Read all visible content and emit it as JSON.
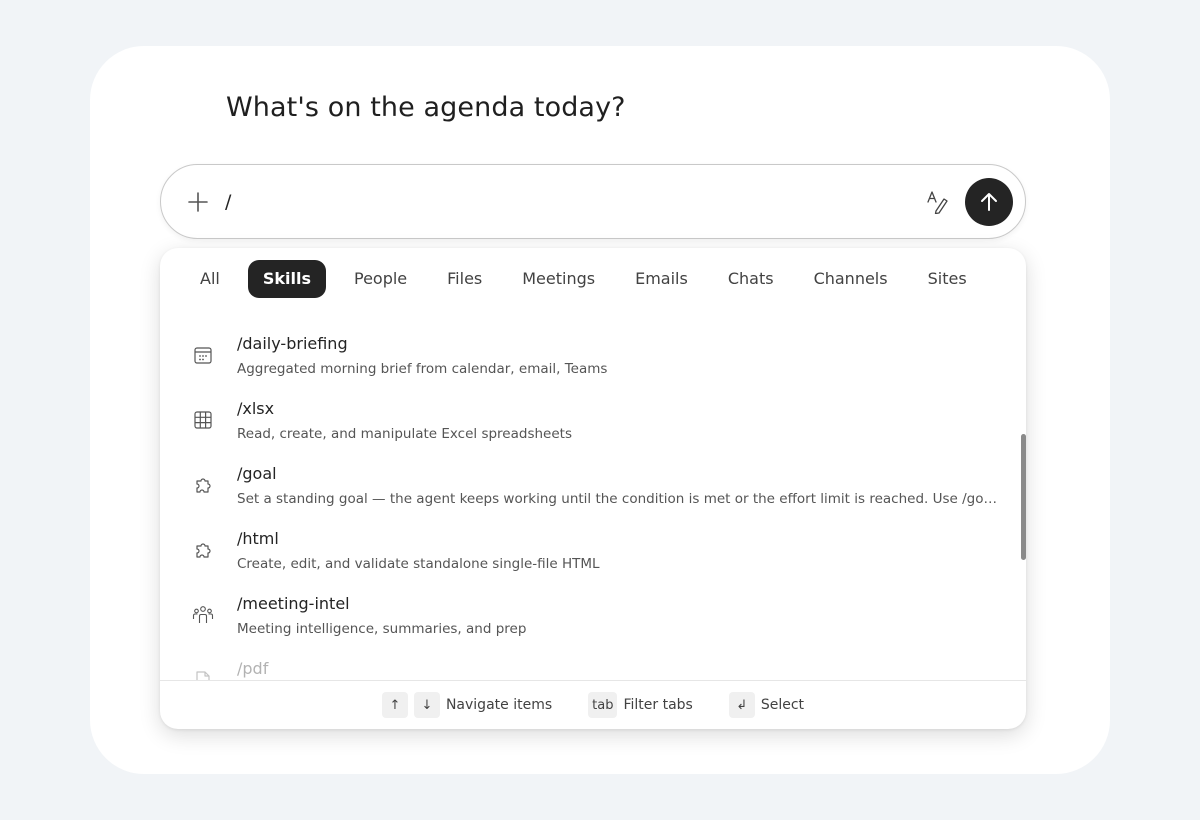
{
  "heading": "What's on the agenda today?",
  "composer": {
    "value": "/",
    "plus_icon": "plus-icon",
    "format_icon": "text-format-icon",
    "send_icon": "arrow-up-icon"
  },
  "tabs": [
    {
      "label": "All",
      "active": false
    },
    {
      "label": "Skills",
      "active": true
    },
    {
      "label": "People",
      "active": false
    },
    {
      "label": "Files",
      "active": false
    },
    {
      "label": "Meetings",
      "active": false
    },
    {
      "label": "Emails",
      "active": false
    },
    {
      "label": "Chats",
      "active": false
    },
    {
      "label": "Channels",
      "active": false
    },
    {
      "label": "Sites",
      "active": false
    }
  ],
  "items": [
    {
      "name": "/daily-briefing",
      "desc": "Aggregated morning brief from calendar, email, Teams",
      "icon": "calendar-icon"
    },
    {
      "name": "/xlsx",
      "desc": "Read, create, and manipulate Excel spreadsheets",
      "icon": "table-icon"
    },
    {
      "name": "/goal",
      "desc": "Set a standing goal — the agent keeps working until the condition is met or the effort limit is reached. Use /goal clear...",
      "icon": "puzzle-icon"
    },
    {
      "name": "/html",
      "desc": "Create, edit, and validate standalone single-file HTML",
      "icon": "puzzle-icon"
    },
    {
      "name": "/meeting-intel",
      "desc": "Meeting intelligence, summaries, and prep",
      "icon": "people-icon"
    },
    {
      "name": "/pdf",
      "desc": "",
      "icon": "document-icon"
    }
  ],
  "footer": {
    "up_key": "↑",
    "down_key": "↓",
    "navigate_label": "Navigate items",
    "tab_key": "tab",
    "filter_label": "Filter tabs",
    "enter_key": "↲",
    "select_label": "Select"
  },
  "colors": {
    "page_bg": "#f1f4f7",
    "active_tab": "#242424",
    "send_button": "#242424"
  }
}
